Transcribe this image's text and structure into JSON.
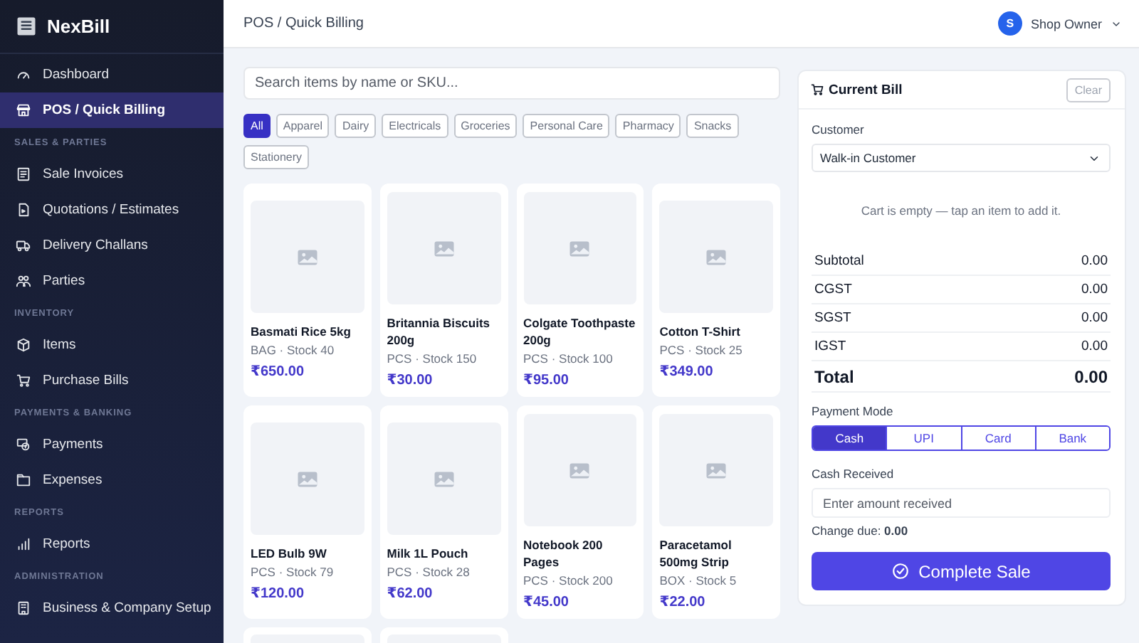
{
  "brand": {
    "name": "NexBill"
  },
  "sidebar": {
    "items": [
      {
        "kind": "item",
        "label": "Dashboard",
        "selected": false
      },
      {
        "kind": "item",
        "label": "POS / Quick Billing",
        "selected": true
      },
      {
        "kind": "section",
        "label": "SALES & PARTIES"
      },
      {
        "kind": "item",
        "label": "Sale Invoices",
        "selected": false
      },
      {
        "kind": "item",
        "label": "Quotations / Estimates",
        "selected": false
      },
      {
        "kind": "item",
        "label": "Delivery Challans",
        "selected": false
      },
      {
        "kind": "item",
        "label": "Parties",
        "selected": false
      },
      {
        "kind": "section",
        "label": "INVENTORY"
      },
      {
        "kind": "item",
        "label": "Items",
        "selected": false
      },
      {
        "kind": "item",
        "label": "Purchase Bills",
        "selected": false
      },
      {
        "kind": "section",
        "label": "PAYMENTS & BANKING"
      },
      {
        "kind": "item",
        "label": "Payments",
        "selected": false
      },
      {
        "kind": "item",
        "label": "Expenses",
        "selected": false
      },
      {
        "kind": "section",
        "label": "REPORTS"
      },
      {
        "kind": "item",
        "label": "Reports",
        "selected": false
      },
      {
        "kind": "section",
        "label": "ADMINISTRATION"
      },
      {
        "kind": "item",
        "label": "Business & Company Setup",
        "selected": false
      }
    ]
  },
  "header": {
    "breadcrumb": "POS / Quick Billing",
    "user": {
      "initial": "S",
      "name": "Shop Owner"
    }
  },
  "search": {
    "placeholder": "Search items by name or SKU..."
  },
  "categories": [
    {
      "label": "All",
      "selected": true
    },
    {
      "label": "Apparel",
      "selected": false
    },
    {
      "label": "Dairy",
      "selected": false
    },
    {
      "label": "Electricals",
      "selected": false
    },
    {
      "label": "Groceries",
      "selected": false
    },
    {
      "label": "Personal Care",
      "selected": false
    },
    {
      "label": "Pharmacy",
      "selected": false
    },
    {
      "label": "Snacks",
      "selected": false
    },
    {
      "label": "Stationery",
      "selected": false
    }
  ],
  "products": [
    {
      "kind": "item",
      "name": "Basmati Rice 5kg",
      "meta": "BAG · Stock 40",
      "price": "₹650.00"
    },
    {
      "kind": "item",
      "name": "Britannia Biscuits 200g",
      "meta": "PCS · Stock 150",
      "price": "₹30.00"
    },
    {
      "kind": "item",
      "name": "Colgate Toothpaste 200g",
      "meta": "PCS · Stock 100",
      "price": "₹95.00"
    },
    {
      "kind": "item",
      "name": "Cotton T-Shirt",
      "meta": "PCS · Stock 25",
      "price": "₹349.00"
    },
    {
      "kind": "item",
      "name": "LED Bulb 9W",
      "meta": "PCS · Stock 79",
      "price": "₹120.00"
    },
    {
      "kind": "item",
      "name": "Milk 1L Pouch",
      "meta": "PCS · Stock 28",
      "price": "₹62.00"
    },
    {
      "kind": "item",
      "name": "Notebook 200 Pages",
      "meta": "PCS · Stock 200",
      "price": "₹45.00"
    },
    {
      "kind": "item",
      "name": "Paracetamol 500mg Strip",
      "meta": "BOX · Stock 5",
      "price": "₹22.00"
    },
    {
      "kind": "cut"
    },
    {
      "kind": "cut"
    }
  ],
  "bill": {
    "title": "Current Bill",
    "clear": "Clear",
    "customer_label": "Customer",
    "customer": "Walk-in Customer",
    "empty_message": "Cart is empty — tap an item to add it.",
    "totals": [
      {
        "kind": "line",
        "label": "Subtotal",
        "value": "0.00"
      },
      {
        "kind": "line",
        "label": "CGST",
        "value": "0.00"
      },
      {
        "kind": "line",
        "label": "SGST",
        "value": "0.00"
      },
      {
        "kind": "line",
        "label": "IGST",
        "value": "0.00"
      },
      {
        "kind": "grand",
        "label": "Total",
        "value": "0.00"
      }
    ],
    "payment_label": "Payment Mode",
    "payment_modes": [
      {
        "label": "Cash",
        "selected": true
      },
      {
        "label": "UPI",
        "selected": false
      },
      {
        "label": "Card",
        "selected": false
      },
      {
        "label": "Bank",
        "selected": false
      }
    ],
    "cash_label": "Cash Received",
    "cash_placeholder": "Enter amount received",
    "change_due": "Change due: **0.00**",
    "submit": "Complete Sale"
  }
}
